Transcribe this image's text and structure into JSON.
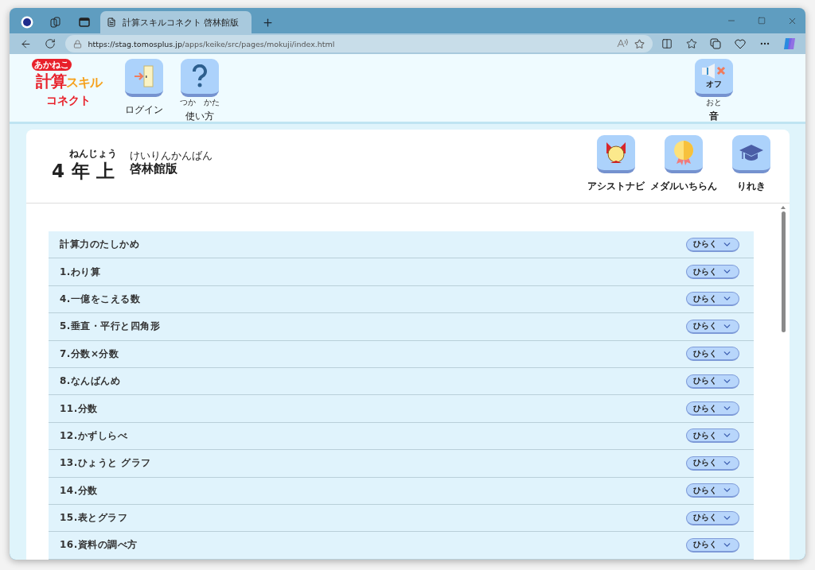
{
  "browser": {
    "tab_title": "計算スキルコネクト 啓林館版",
    "url_host": "https://stag.tomosplus.jp",
    "url_path": "/apps/keike/src/pages/mokuji/index.html"
  },
  "header": {
    "logo": {
      "top": "あかねこ",
      "main_a": "計算",
      "main_b": "スキル",
      "bottom": "コネクト"
    },
    "buttons": [
      {
        "kind": "login",
        "label": "ログイン"
      },
      {
        "kind": "help",
        "label": "使い方",
        "reading": "つか　かた"
      }
    ],
    "sound": {
      "kind": "sound",
      "state_label": "オフ",
      "label": "音",
      "reading": "おと",
      "on": false
    }
  },
  "book": {
    "grade": "4",
    "grade_reading": "ねんじょう",
    "term": "年 上",
    "edition": "啓林館版",
    "edition_reading": "けいりんかんばん",
    "tools": [
      {
        "kind": "cat",
        "label": "アシストナビ"
      },
      {
        "kind": "medal",
        "label": "メダルいちらん"
      },
      {
        "kind": "cap",
        "label": "りれき"
      }
    ]
  },
  "units": [
    {
      "title": "計算力のたしかめ",
      "button": "ひらく",
      "expanded": false
    },
    {
      "title": "1.わり算",
      "button": "ひらく",
      "expanded": false
    },
    {
      "title": "4.一億をこえる数",
      "button": "ひらく",
      "expanded": false
    },
    {
      "title": "5.垂直・平行と四角形",
      "button": "ひらく",
      "expanded": false
    },
    {
      "title": "7.分数×分数",
      "button": "ひらく",
      "expanded": false
    },
    {
      "title": "8.なんばんめ",
      "button": "ひらく",
      "expanded": false
    },
    {
      "title": "11.分数",
      "button": "ひらく",
      "expanded": false
    },
    {
      "title": "12.かずしらべ",
      "button": "ひらく",
      "expanded": false
    },
    {
      "title": "13.ひょうと グラフ",
      "button": "ひらく",
      "expanded": false
    },
    {
      "title": "14.分数",
      "button": "ひらく",
      "expanded": false
    },
    {
      "title": "15.表とグラフ",
      "button": "ひらく",
      "expanded": false
    },
    {
      "title": "16.資料の調べ方",
      "button": "ひらく",
      "expanded": false
    }
  ]
}
